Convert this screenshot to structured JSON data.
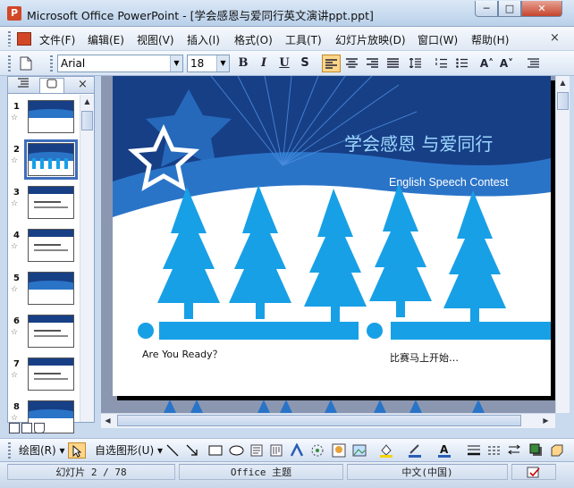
{
  "window": {
    "title": "Microsoft Office PowerPoint - [学会感恩与爱同行英文演讲ppt.ppt]",
    "buttons": {
      "minimize": "─",
      "maximize": "□",
      "close": "✕"
    }
  },
  "menu": {
    "items": [
      "文件(F)",
      "编辑(E)",
      "视图(V)",
      "插入(I)",
      "格式(O)",
      "工具(T)",
      "幻灯片放映(D)",
      "窗口(W)",
      "帮助(H)"
    ],
    "close_doc": "×"
  },
  "format_toolbar": {
    "font": "Arial",
    "size": "18",
    "bold": "B",
    "italic": "I",
    "underline": "U",
    "shadow": "S",
    "grow_font": "A˄",
    "shrink_font": "A˅"
  },
  "pane": {
    "close": "×",
    "thumbnails": [
      {
        "num": "1",
        "kind": "title"
      },
      {
        "num": "2",
        "kind": "trees",
        "selected": true
      },
      {
        "num": "3",
        "kind": "content"
      },
      {
        "num": "4",
        "kind": "content"
      },
      {
        "num": "5",
        "kind": "title"
      },
      {
        "num": "6",
        "kind": "content"
      },
      {
        "num": "7",
        "kind": "content"
      },
      {
        "num": "8",
        "kind": "title"
      }
    ]
  },
  "slide": {
    "title": "学会感恩 与爱同行",
    "subtitle": "English Speech Contest",
    "left_caption": "Are You Ready？",
    "right_caption": "比赛马上开始…",
    "colors": {
      "dark_blue": "#173f86",
      "mid_blue": "#2a74c8",
      "tree_blue": "#18a0e6",
      "title": "#9fd8ff"
    }
  },
  "draw_toolbar": {
    "draw": "绘图(R) ▾",
    "autoshapes": "自选图形(U) ▾"
  },
  "status": {
    "slide": "幻灯片 2 / 78",
    "theme": "Office 主题",
    "language": "中文(中国)"
  }
}
